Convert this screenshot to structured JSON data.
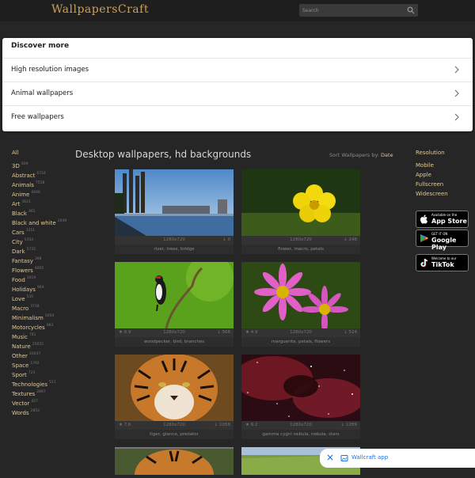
{
  "header": {
    "logo": "WallpapersCraft",
    "search_placeholder": "Search"
  },
  "discover": {
    "title": "Discover more",
    "items": [
      "High resolution images",
      "Animal wallpapers",
      "Free wallpapers"
    ]
  },
  "sidebar": {
    "all_label": "All",
    "categories": [
      {
        "name": "3D",
        "count": "609"
      },
      {
        "name": "Abstract",
        "count": "6724"
      },
      {
        "name": "Animals",
        "count": "7558"
      },
      {
        "name": "Anime",
        "count": "4440"
      },
      {
        "name": "Art",
        "count": "3621"
      },
      {
        "name": "Black",
        "count": "461"
      },
      {
        "name": "Black and white",
        "count": "2049"
      },
      {
        "name": "Cars",
        "count": "3351"
      },
      {
        "name": "City",
        "count": "5354"
      },
      {
        "name": "Dark",
        "count": "5735"
      },
      {
        "name": "Fantasy",
        "count": "398"
      },
      {
        "name": "Flowers",
        "count": "4005"
      },
      {
        "name": "Food",
        "count": "3019"
      },
      {
        "name": "Holidays",
        "count": "864"
      },
      {
        "name": "Love",
        "count": "535"
      },
      {
        "name": "Macro",
        "count": "3718"
      },
      {
        "name": "Minimalism",
        "count": "5059"
      },
      {
        "name": "Motorcycles",
        "count": "893"
      },
      {
        "name": "Music",
        "count": "761"
      },
      {
        "name": "Nature",
        "count": "25655"
      },
      {
        "name": "Other",
        "count": "10037"
      },
      {
        "name": "Space",
        "count": "1792"
      },
      {
        "name": "Sport",
        "count": "723"
      },
      {
        "name": "Technologies",
        "count": "511"
      },
      {
        "name": "Textures",
        "count": "2867"
      },
      {
        "name": "Vector",
        "count": "427"
      },
      {
        "name": "Words",
        "count": "2852"
      }
    ]
  },
  "main": {
    "heading": "Desktop wallpapers, hd backgrounds",
    "sort_label": "Sort Wallpapers by:",
    "sort_value": "Date"
  },
  "wallpapers": [
    {
      "rating": "",
      "res": "1280x720",
      "downloads": "0",
      "tags": "river, trees, bridge"
    },
    {
      "rating": "",
      "res": "1280x720",
      "downloads": "248",
      "tags": "flower, macro, petals"
    },
    {
      "rating": "6.9",
      "res": "1280x720",
      "downloads": "566",
      "tags": "woodpecker, bird, branches"
    },
    {
      "rating": "4.9",
      "res": "1280x720",
      "downloads": "524",
      "tags": "marguerite, petals, flowers"
    },
    {
      "rating": "7.6",
      "res": "1280x720",
      "downloads": "1058",
      "tags": "tiger, glance, predator"
    },
    {
      "rating": "6.2",
      "res": "1280x720",
      "downloads": "1289",
      "tags": "gamma cygni nebula, nebula, stars"
    }
  ],
  "right_sidebar": {
    "resolution_title": "Resolution",
    "items": [
      "Mobile",
      "Apple",
      "Fullscreen",
      "Widescreen"
    ]
  },
  "badges": [
    {
      "small": "Available on the",
      "big": "App Store",
      "icon": "apple-icon"
    },
    {
      "small": "GET IT ON",
      "big": "Google Play",
      "icon": "google-play-icon"
    },
    {
      "small": "Welcome to our",
      "big": "TikTok",
      "icon": "tiktok-icon"
    }
  ],
  "app_bar": {
    "label": "Wallcraft app"
  }
}
